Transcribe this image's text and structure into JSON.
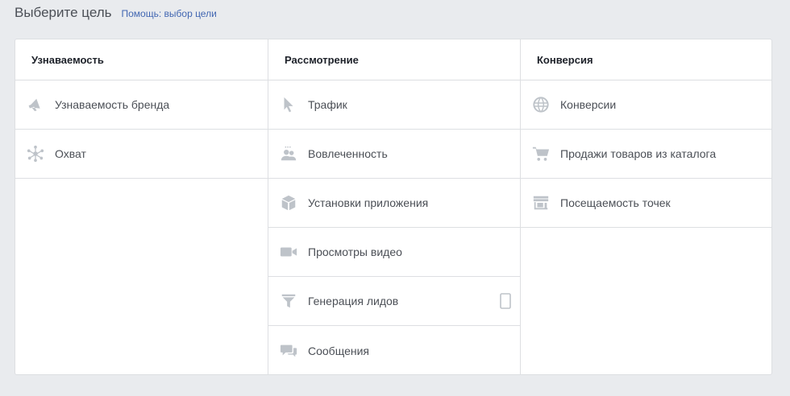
{
  "header": {
    "title": "Выберите цель",
    "help_link": "Помощь: выбор цели"
  },
  "columns": [
    {
      "heading": "Узнаваемость",
      "items": [
        {
          "label": "Узнаваемость бренда",
          "icon": "megaphone-icon"
        },
        {
          "label": "Охват",
          "icon": "reach-icon"
        }
      ]
    },
    {
      "heading": "Рассмотрение",
      "items": [
        {
          "label": "Трафик",
          "icon": "cursor-icon"
        },
        {
          "label": "Вовлеченность",
          "icon": "people-icon"
        },
        {
          "label": "Установки приложения",
          "icon": "box-icon"
        },
        {
          "label": "Просмотры видео",
          "icon": "video-camera-icon"
        },
        {
          "label": "Генерация лидов",
          "icon": "funnel-icon",
          "extra_icon": "mobile-device-icon"
        },
        {
          "label": "Сообщения",
          "icon": "chat-bubbles-icon"
        }
      ]
    },
    {
      "heading": "Конверсия",
      "items": [
        {
          "label": "Конверсии",
          "icon": "globe-icon"
        },
        {
          "label": "Продажи товаров из каталога",
          "icon": "shopping-cart-icon"
        },
        {
          "label": "Посещаемость точек",
          "icon": "store-icon"
        }
      ]
    }
  ],
  "colors": {
    "background": "#e9ebee",
    "border": "#dddfe2",
    "icon": "#bec3c9",
    "link": "#4267b2",
    "text": "#4b4f56"
  }
}
